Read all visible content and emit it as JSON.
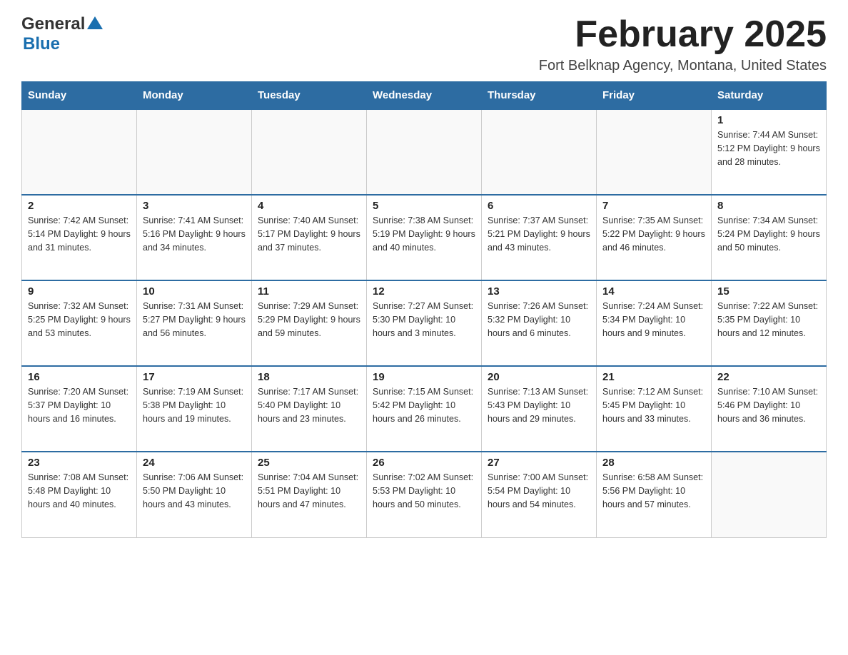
{
  "header": {
    "logo_general": "General",
    "logo_blue": "Blue",
    "month_title": "February 2025",
    "location": "Fort Belknap Agency, Montana, United States"
  },
  "weekdays": [
    "Sunday",
    "Monday",
    "Tuesday",
    "Wednesday",
    "Thursday",
    "Friday",
    "Saturday"
  ],
  "weeks": [
    [
      {
        "day": "",
        "info": ""
      },
      {
        "day": "",
        "info": ""
      },
      {
        "day": "",
        "info": ""
      },
      {
        "day": "",
        "info": ""
      },
      {
        "day": "",
        "info": ""
      },
      {
        "day": "",
        "info": ""
      },
      {
        "day": "1",
        "info": "Sunrise: 7:44 AM\nSunset: 5:12 PM\nDaylight: 9 hours and 28 minutes."
      }
    ],
    [
      {
        "day": "2",
        "info": "Sunrise: 7:42 AM\nSunset: 5:14 PM\nDaylight: 9 hours and 31 minutes."
      },
      {
        "day": "3",
        "info": "Sunrise: 7:41 AM\nSunset: 5:16 PM\nDaylight: 9 hours and 34 minutes."
      },
      {
        "day": "4",
        "info": "Sunrise: 7:40 AM\nSunset: 5:17 PM\nDaylight: 9 hours and 37 minutes."
      },
      {
        "day": "5",
        "info": "Sunrise: 7:38 AM\nSunset: 5:19 PM\nDaylight: 9 hours and 40 minutes."
      },
      {
        "day": "6",
        "info": "Sunrise: 7:37 AM\nSunset: 5:21 PM\nDaylight: 9 hours and 43 minutes."
      },
      {
        "day": "7",
        "info": "Sunrise: 7:35 AM\nSunset: 5:22 PM\nDaylight: 9 hours and 46 minutes."
      },
      {
        "day": "8",
        "info": "Sunrise: 7:34 AM\nSunset: 5:24 PM\nDaylight: 9 hours and 50 minutes."
      }
    ],
    [
      {
        "day": "9",
        "info": "Sunrise: 7:32 AM\nSunset: 5:25 PM\nDaylight: 9 hours and 53 minutes."
      },
      {
        "day": "10",
        "info": "Sunrise: 7:31 AM\nSunset: 5:27 PM\nDaylight: 9 hours and 56 minutes."
      },
      {
        "day": "11",
        "info": "Sunrise: 7:29 AM\nSunset: 5:29 PM\nDaylight: 9 hours and 59 minutes."
      },
      {
        "day": "12",
        "info": "Sunrise: 7:27 AM\nSunset: 5:30 PM\nDaylight: 10 hours and 3 minutes."
      },
      {
        "day": "13",
        "info": "Sunrise: 7:26 AM\nSunset: 5:32 PM\nDaylight: 10 hours and 6 minutes."
      },
      {
        "day": "14",
        "info": "Sunrise: 7:24 AM\nSunset: 5:34 PM\nDaylight: 10 hours and 9 minutes."
      },
      {
        "day": "15",
        "info": "Sunrise: 7:22 AM\nSunset: 5:35 PM\nDaylight: 10 hours and 12 minutes."
      }
    ],
    [
      {
        "day": "16",
        "info": "Sunrise: 7:20 AM\nSunset: 5:37 PM\nDaylight: 10 hours and 16 minutes."
      },
      {
        "day": "17",
        "info": "Sunrise: 7:19 AM\nSunset: 5:38 PM\nDaylight: 10 hours and 19 minutes."
      },
      {
        "day": "18",
        "info": "Sunrise: 7:17 AM\nSunset: 5:40 PM\nDaylight: 10 hours and 23 minutes."
      },
      {
        "day": "19",
        "info": "Sunrise: 7:15 AM\nSunset: 5:42 PM\nDaylight: 10 hours and 26 minutes."
      },
      {
        "day": "20",
        "info": "Sunrise: 7:13 AM\nSunset: 5:43 PM\nDaylight: 10 hours and 29 minutes."
      },
      {
        "day": "21",
        "info": "Sunrise: 7:12 AM\nSunset: 5:45 PM\nDaylight: 10 hours and 33 minutes."
      },
      {
        "day": "22",
        "info": "Sunrise: 7:10 AM\nSunset: 5:46 PM\nDaylight: 10 hours and 36 minutes."
      }
    ],
    [
      {
        "day": "23",
        "info": "Sunrise: 7:08 AM\nSunset: 5:48 PM\nDaylight: 10 hours and 40 minutes."
      },
      {
        "day": "24",
        "info": "Sunrise: 7:06 AM\nSunset: 5:50 PM\nDaylight: 10 hours and 43 minutes."
      },
      {
        "day": "25",
        "info": "Sunrise: 7:04 AM\nSunset: 5:51 PM\nDaylight: 10 hours and 47 minutes."
      },
      {
        "day": "26",
        "info": "Sunrise: 7:02 AM\nSunset: 5:53 PM\nDaylight: 10 hours and 50 minutes."
      },
      {
        "day": "27",
        "info": "Sunrise: 7:00 AM\nSunset: 5:54 PM\nDaylight: 10 hours and 54 minutes."
      },
      {
        "day": "28",
        "info": "Sunrise: 6:58 AM\nSunset: 5:56 PM\nDaylight: 10 hours and 57 minutes."
      },
      {
        "day": "",
        "info": ""
      }
    ]
  ]
}
